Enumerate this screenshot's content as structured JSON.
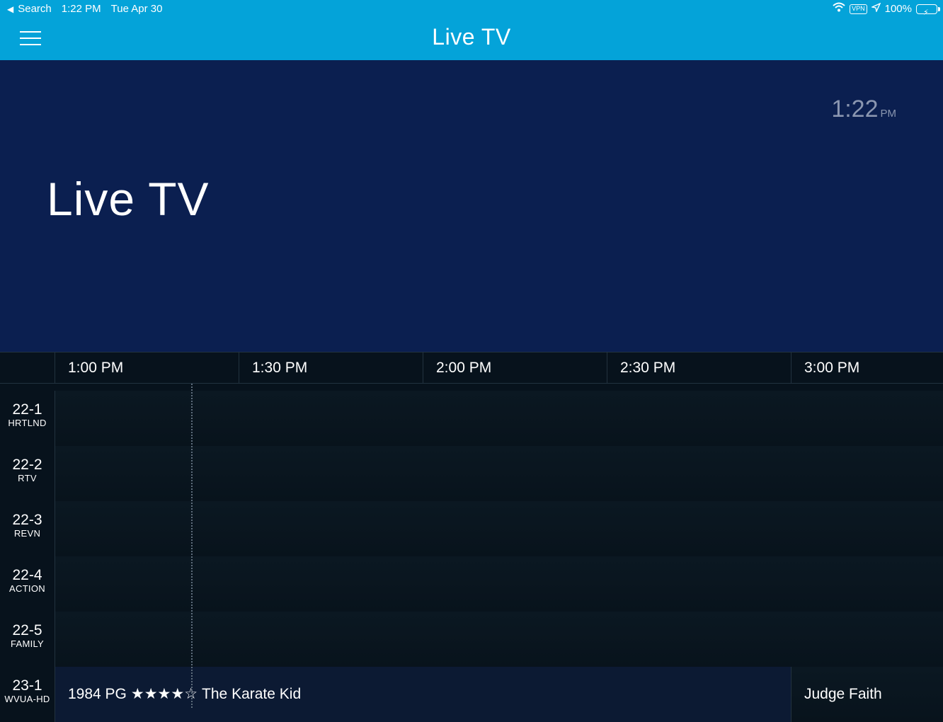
{
  "status_bar": {
    "back_label": "Search",
    "time": "1:22 PM",
    "date": "Tue Apr 30",
    "vpn": "VPN",
    "battery": "100%"
  },
  "nav": {
    "title": "Live TV"
  },
  "hero": {
    "clock_time": "1:22",
    "clock_ampm": "PM",
    "title": "Live TV"
  },
  "guide": {
    "time_slots": [
      "1:00 PM",
      "1:30 PM",
      "2:00 PM",
      "2:30 PM",
      "3:00 PM"
    ],
    "channels": [
      {
        "number": "22-1",
        "callsign": "HRTLND"
      },
      {
        "number": "22-2",
        "callsign": "RTV"
      },
      {
        "number": "22-3",
        "callsign": "REVN"
      },
      {
        "number": "22-4",
        "callsign": "ACTION"
      },
      {
        "number": "22-5",
        "callsign": "FAMILY"
      },
      {
        "number": "23-1",
        "callsign": "WVUA-HD"
      }
    ],
    "program_23_1_a": {
      "year_rating": "1984 PG",
      "stars": "★★★★☆",
      "rating_value": 4,
      "title": "The Karate Kid"
    },
    "program_23_1_b": {
      "title": "Judge Faith"
    }
  },
  "colors": {
    "nav_bar": "#04a3d9",
    "hero_bg": "#0b1f50",
    "guide_bg": "#06101a"
  }
}
